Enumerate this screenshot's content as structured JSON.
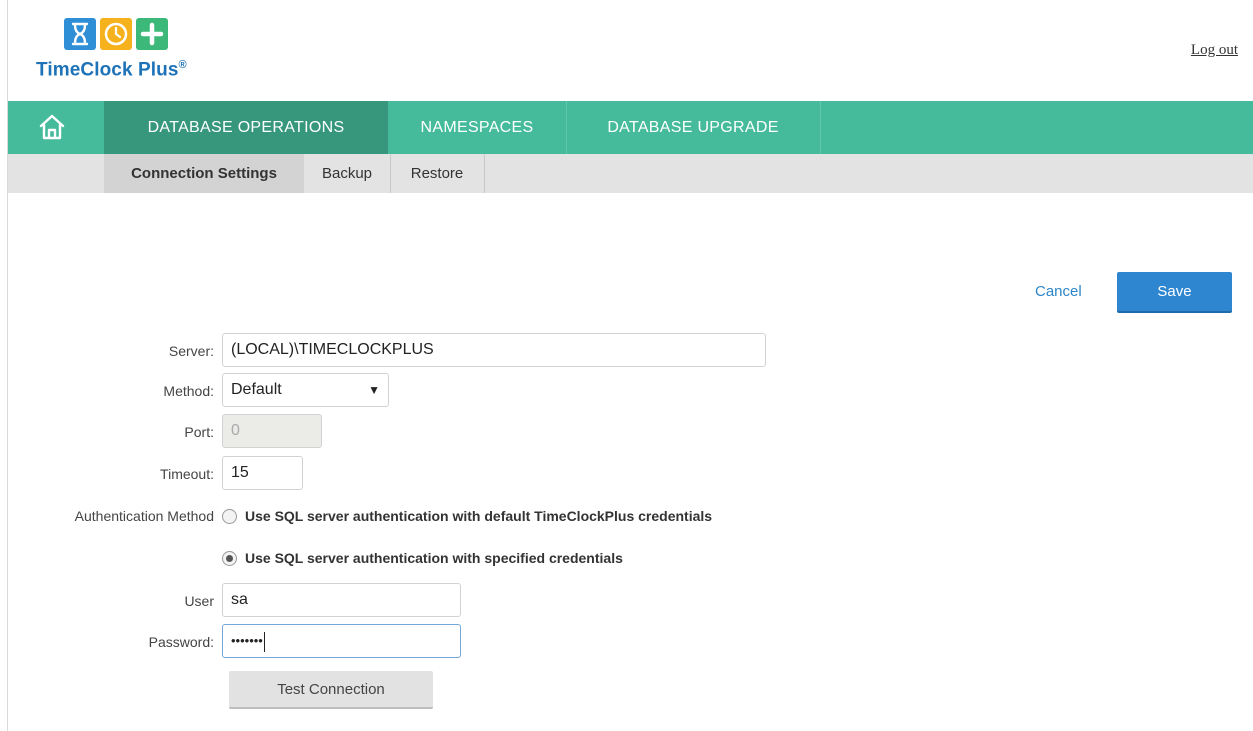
{
  "header": {
    "logo_text": "TimeClock Plus",
    "logo_mark": "®",
    "logo_icons": [
      "hourglass-icon",
      "clock-icon",
      "plus-icon"
    ],
    "logout_label": "Log out"
  },
  "mainnav": {
    "home_icon": "home-icon",
    "tabs": [
      {
        "label": "DATABASE OPERATIONS",
        "active": true
      },
      {
        "label": "NAMESPACES",
        "active": false
      },
      {
        "label": "DATABASE UPGRADE",
        "active": false
      }
    ]
  },
  "subnav": {
    "tabs": [
      {
        "label": "Connection Settings",
        "active": true
      },
      {
        "label": "Backup",
        "active": false
      },
      {
        "label": "Restore",
        "active": false
      }
    ]
  },
  "actions": {
    "cancel_label": "Cancel",
    "save_label": "Save"
  },
  "form": {
    "server": {
      "label": "Server:",
      "value": "(LOCAL)\\TIMECLOCKPLUS"
    },
    "method": {
      "label": "Method:",
      "value": "Default"
    },
    "port": {
      "label": "Port:",
      "value": "0"
    },
    "timeout": {
      "label": "Timeout:",
      "value": "15"
    },
    "auth": {
      "label": "Authentication Method",
      "options": [
        {
          "label": "Use SQL server authentication with default TimeClockPlus credentials",
          "checked": false
        },
        {
          "label": "Use SQL server authentication with specified credentials",
          "checked": true
        }
      ]
    },
    "user": {
      "label": "User",
      "value": "sa"
    },
    "password": {
      "label": "Password:",
      "value": "•••••••"
    },
    "test_label": "Test Connection"
  },
  "colors": {
    "nav_green": "#45bb9b",
    "nav_active": "#37977c",
    "primary_blue": "#2e86d0",
    "subnav_gray": "#e3e3e3"
  }
}
